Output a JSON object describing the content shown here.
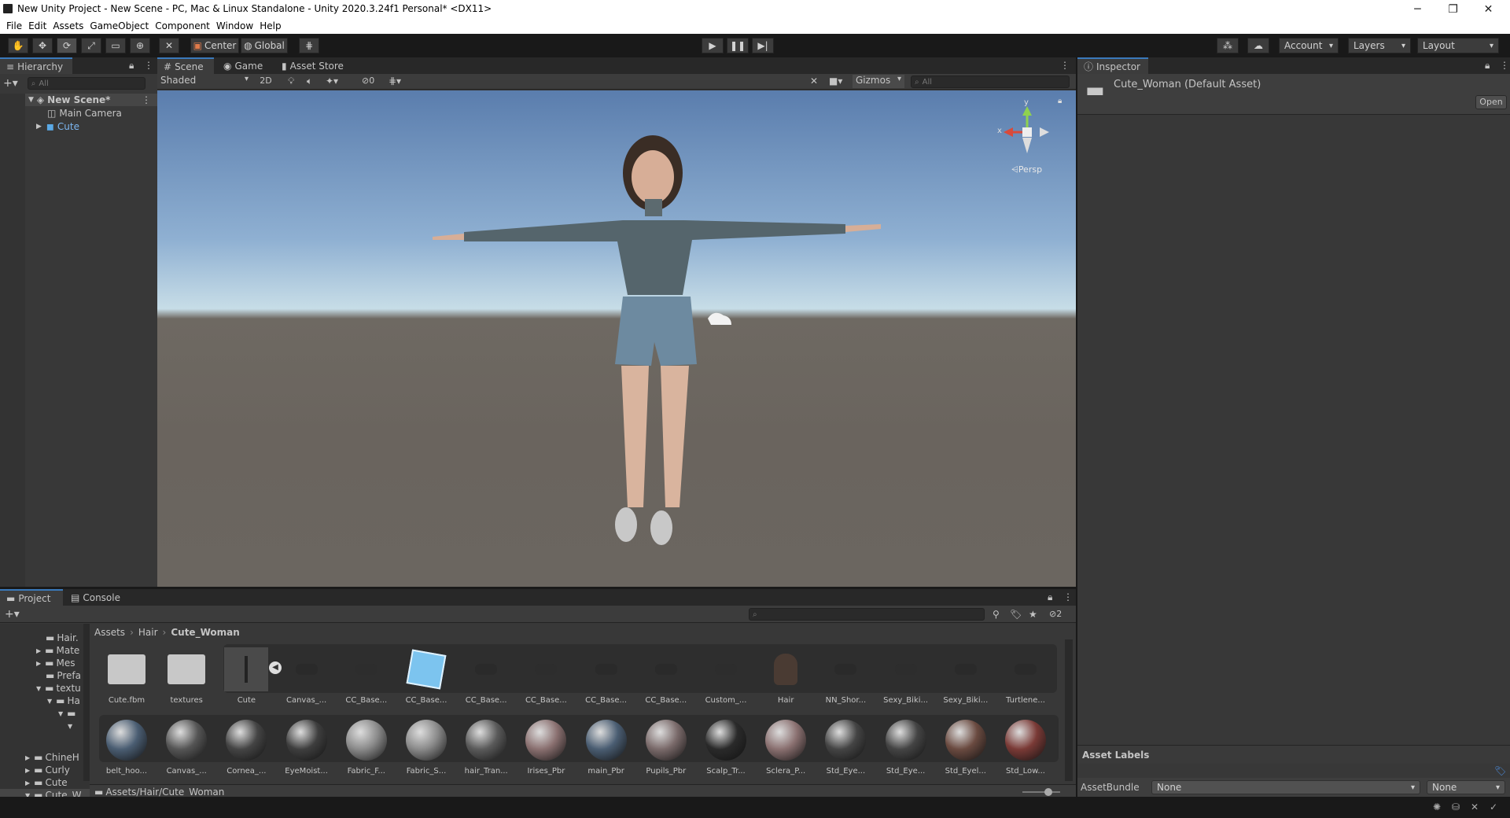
{
  "window": {
    "title": "New Unity Project - New Scene - PC, Mac & Linux Standalone - Unity 2020.3.24f1 Personal* <DX11>",
    "minimize": "─",
    "maximize": "❐",
    "close": "✕"
  },
  "menu": [
    "File",
    "Edit",
    "Assets",
    "GameObject",
    "Component",
    "Window",
    "Help"
  ],
  "toolbar": {
    "pivot": "Center",
    "space": "Global",
    "account": "Account",
    "layers": "Layers",
    "layout": "Layout"
  },
  "hierarchy": {
    "tab": "Hierarchy",
    "search_placeholder": "All",
    "scene": "New Scene*",
    "items": [
      "Main Camera",
      "Cute"
    ]
  },
  "scene": {
    "tabs": [
      "Scene",
      "Game",
      "Asset Store"
    ],
    "shading": "Shaded",
    "mode2d": "2D",
    "hidden_count": "0",
    "gizmos": "Gizmos",
    "search_placeholder": "All",
    "persp": "Persp",
    "axis_x": "x",
    "axis_y": "y"
  },
  "inspector": {
    "tab": "Inspector",
    "asset_name": "Cute_Woman (Default Asset)",
    "open": "Open",
    "labels_title": "Asset Labels",
    "assetbundle_label": "AssetBundle",
    "assetbundle_value": "None",
    "variant_value": "None"
  },
  "project": {
    "tabs": [
      "Project",
      "Console"
    ],
    "hidden_count": "2",
    "breadcrumb": [
      "Assets",
      "Hair",
      "Cute_Woman"
    ],
    "path": "Assets/Hair/Cute_Woman",
    "tree": [
      "Hair.",
      "Mate",
      "Mes",
      "Prefa",
      "textu",
      "Ha",
      "ChineH",
      "Curly",
      "Cute",
      "Cute_W"
    ],
    "row1": [
      "Cute.fbm",
      "textures",
      "Cute",
      "Canvas_...",
      "CC_Base...",
      "CC_Base...",
      "CC_Base...",
      "CC_Base...",
      "CC_Base...",
      "CC_Base...",
      "Custom_...",
      "Hair",
      "NN_Shor...",
      "Sexy_Biki...",
      "Sexy_Biki...",
      "Turtlene..."
    ],
    "row2": [
      "belt_hoo...",
      "Canvas_...",
      "Cornea_...",
      "EyeMoist...",
      "Fabric_F...",
      "Fabric_S...",
      "hair_Tran...",
      "Irises_Pbr",
      "main_Pbr",
      "Pupils_Pbr",
      "Scalp_Tr...",
      "Sclera_P...",
      "Std_Eye...",
      "Std_Eye...",
      "Std_Eyel...",
      "Std_Low..."
    ]
  }
}
